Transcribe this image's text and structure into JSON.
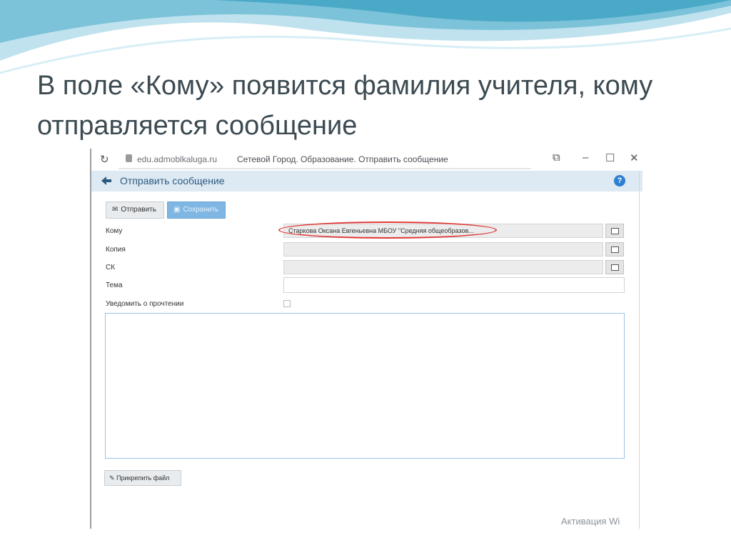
{
  "slide": {
    "title": "В поле «Кому» появится фамилия учителя, кому отправляется сообщение"
  },
  "browser": {
    "url": "edu.admoblkaluga.ru",
    "page_title": "Сетевой Город. Образование. Отправить сообщение"
  },
  "header": {
    "title": "Отправить сообщение",
    "help_label": "?"
  },
  "toolbar": {
    "send_label": "Отправить",
    "save_label": "Сохранить"
  },
  "form": {
    "to_label": "Кому",
    "to_value": "Старкова Оксана Евгеньевна МБОУ \"Средняя общеобразов...",
    "copy_label": "Копия",
    "cc_label": "СК",
    "subject_label": "Тема",
    "notify_label": "Уведомить о прочтении"
  },
  "attach": {
    "label": "Прикрепить файл"
  },
  "watermark": "Активация Wi"
}
